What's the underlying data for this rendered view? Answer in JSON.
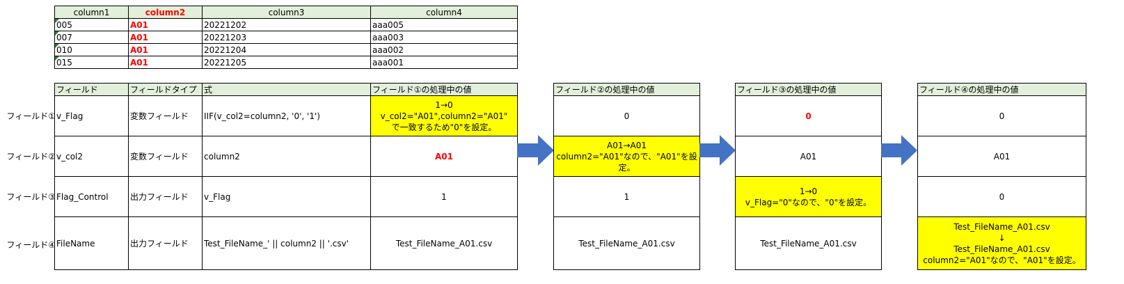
{
  "top_table": {
    "headers": [
      "column1",
      "column2",
      "column3",
      "column4"
    ],
    "rows": [
      [
        "005",
        "A01",
        "20221202",
        "aaa005"
      ],
      [
        "007",
        "A01",
        "20221203",
        "aaa003"
      ],
      [
        "010",
        "A01",
        "20221204",
        "aaa002"
      ],
      [
        "015",
        "A01",
        "20221205",
        "aaa001"
      ]
    ]
  },
  "field_table": {
    "headers": [
      "フィールド",
      "フィールドタイプ",
      "式",
      "フィールド①の処理中の値"
    ],
    "row_labels": [
      "フィールド①",
      "フィールド②",
      "フィールド③",
      "フィールド④"
    ],
    "rows": [
      {
        "name": "v_Flag",
        "type": "変数フィールド",
        "expr": "IIF(v_col2=column2, '0', '1')",
        "value_lines": [
          "1→0",
          "v_col2=\"A01\",column2=\"A01\"",
          "で一致するため\"0\"を設定。"
        ]
      },
      {
        "name": "v_col2",
        "type": "変数フィールド",
        "expr": "column2",
        "value": "A01"
      },
      {
        "name": "Flag_Control",
        "type": "出力フィールド",
        "expr": "v_Flag",
        "value": "1"
      },
      {
        "name": "FileName",
        "type": "出力フィールド",
        "expr": "Test_FileName_' || column2 || '.csv'",
        "value": "Test_FileName_A01.csv"
      }
    ]
  },
  "stage2": {
    "header": "フィールド②の処理中の値",
    "r1": "0",
    "r2_lines": [
      "A01→A01",
      "column2=\"A01\"なので、\"A01\"を設",
      "定。"
    ],
    "r3": "1",
    "r4": "Test_FileName_A01.csv"
  },
  "stage3": {
    "header": "フィールド③の処理中の値",
    "r1": "0",
    "r2": "A01",
    "r3_lines": [
      "1→0",
      "v_Flag=\"0\"なので、\"0\"を設定。"
    ],
    "r4": "Test_FileName_A01.csv"
  },
  "stage4": {
    "header": "フィールド④の処理中の値",
    "r1": "0",
    "r2": "A01",
    "r3": "0",
    "r4_lines": [
      "Test_FileName_A01.csv",
      "↓",
      "Test_FileName_A01.csv",
      "column2=\"A01\"なので、\"A01\"を設定。"
    ]
  },
  "colors": {
    "header_bg": "#e2efda",
    "highlight": "#ffff00",
    "accent_red": "#ff0000",
    "arrow": "#4472c4"
  }
}
